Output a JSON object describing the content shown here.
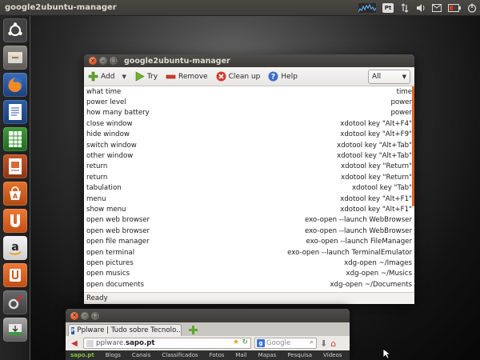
{
  "panel": {
    "title": "google2ubuntu-manager"
  },
  "indicators": [
    {
      "icon": "network-graph-icon"
    },
    {
      "icon": "keyboard-layout-icon",
      "label": "Pt"
    },
    {
      "icon": "transfer-arrows-icon"
    },
    {
      "icon": "volume-icon"
    },
    {
      "icon": "mail-icon"
    },
    {
      "icon": "battery-icon"
    },
    {
      "icon": "power-gear-icon"
    }
  ],
  "launcher": [
    {
      "icon": "ubuntu-dash-icon"
    },
    {
      "icon": "file-manager-icon"
    },
    {
      "icon": "firefox-icon"
    },
    {
      "icon": "writer-document-icon"
    },
    {
      "icon": "calc-spreadsheet-icon"
    },
    {
      "icon": "impress-presentation-icon"
    },
    {
      "icon": "software-center-icon"
    },
    {
      "icon": "ubuntu-one-icon"
    },
    {
      "icon": "amazon-icon"
    },
    {
      "icon": "ubuntu-one-music-icon"
    },
    {
      "icon": "system-settings-icon"
    },
    {
      "icon": "backup-tool-icon"
    }
  ],
  "window": {
    "title": "google2ubuntu-manager",
    "toolbar": {
      "add": "Add",
      "try": "Try",
      "remove": "Remove",
      "cleanup": "Clean up",
      "help": "Help",
      "filter": "All"
    },
    "rows": [
      {
        "phrase": "what time",
        "command": "time"
      },
      {
        "phrase": "power level",
        "command": "power"
      },
      {
        "phrase": "how many battery",
        "command": "power"
      },
      {
        "phrase": "close window",
        "command": "xdotool key \"Alt+F4\""
      },
      {
        "phrase": "hide window",
        "command": "xdotool key \"Alt+F9\""
      },
      {
        "phrase": "switch window",
        "command": "xdotool key \"Alt+Tab\""
      },
      {
        "phrase": "other window",
        "command": "xdotool key \"Alt+Tab\""
      },
      {
        "phrase": "return",
        "command": "xdotool key \"Return\""
      },
      {
        "phrase": "return",
        "command": "xdotool key \"Return\""
      },
      {
        "phrase": "tabulation",
        "command": "xdotool key \"Tab\""
      },
      {
        "phrase": "menu",
        "command": "xdotool key \"Alt+F1\""
      },
      {
        "phrase": "show menu",
        "command": "xdotool key \"Alt+F1\""
      },
      {
        "phrase": "open web browser",
        "command": "exo-open --launch WebBrowser"
      },
      {
        "phrase": "open web browser",
        "command": "exo-open --launch WebBrowser"
      },
      {
        "phrase": "open file manager",
        "command": "exo-open --launch FileManager"
      },
      {
        "phrase": "open terminal",
        "command": "exo-open --launch TerminalEmulator"
      },
      {
        "phrase": "open pictures",
        "command": "xdg-open ~/Images"
      },
      {
        "phrase": "open musics",
        "command": "xdg-open ~/Musics"
      },
      {
        "phrase": "open documents",
        "command": "xdg-open ~/Documents"
      }
    ],
    "status": "Ready"
  },
  "browser": {
    "tab_title": "Pplware | Tudo sobre Tecnolo...",
    "url_host": "pplware.",
    "url_domain": "sapo.pt",
    "search_placeholder": "Google",
    "links": [
      "sapo.pt",
      "Blogs",
      "Canais",
      "Classificados",
      "Fotos",
      "Mail",
      "Mapas",
      "Pesquisa",
      "Vídeos"
    ]
  },
  "colors": {
    "accent_orange": "#e0692b",
    "panel_dark": "#3c3b37",
    "window_bg": "#f2f1f0"
  }
}
